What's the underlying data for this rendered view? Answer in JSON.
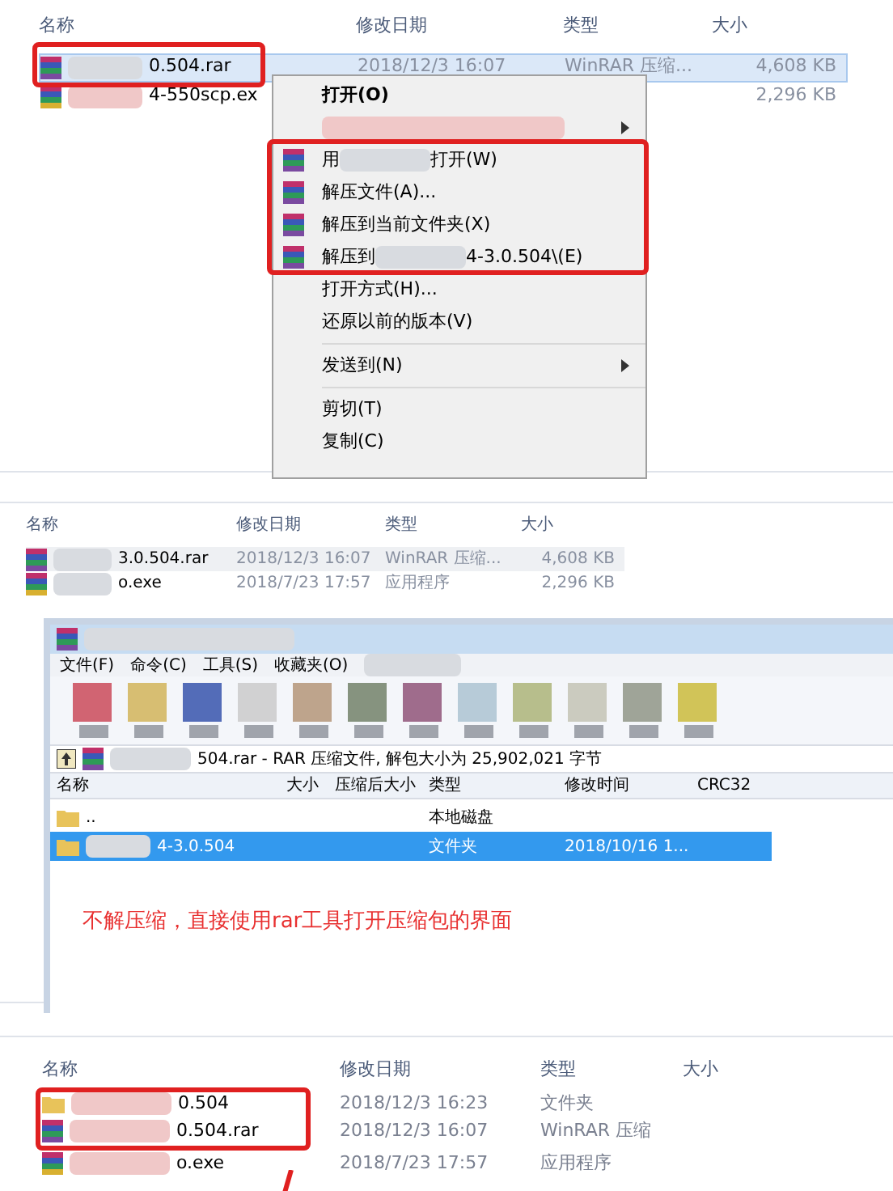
{
  "panel_1": {
    "columns": [
      "名称",
      "修改日期",
      "类型",
      "大小"
    ],
    "rows": [
      {
        "name": "0.504.rar",
        "kind": "rar",
        "date": "2018/12/3 16:07",
        "type": "WinRAR 压缩...",
        "size": "4,608 KB",
        "selected": true
      },
      {
        "name": "4-550scp.ex",
        "kind": "exe",
        "date": "",
        "type": "",
        "size": "2,296 KB",
        "selected": false
      }
    ],
    "context_menu": [
      {
        "kind": "bold",
        "parts": [
          "打开(O)"
        ],
        "submenu": false
      },
      {
        "kind": "blurred",
        "submenu": true
      },
      {
        "kind": "winrar",
        "parts": [
          "用",
          "打开(W)"
        ],
        "submenu": false
      },
      {
        "kind": "winrar",
        "parts": [
          "解压文件(A)..."
        ],
        "submenu": false
      },
      {
        "kind": "winrar",
        "parts": [
          "解压到当前文件夹(X)"
        ],
        "submenu": false
      },
      {
        "kind": "winrar",
        "parts": [
          "解压到",
          "4-3.0.504\\(E)"
        ],
        "submenu": false
      },
      {
        "kind": "plain",
        "parts": [
          "打开方式(H)..."
        ],
        "submenu": false
      },
      {
        "kind": "plain",
        "parts": [
          "还原以前的版本(V)"
        ],
        "submenu": false
      },
      {
        "kind": "separator"
      },
      {
        "kind": "plain",
        "parts": [
          "发送到(N)"
        ],
        "submenu": true
      },
      {
        "kind": "separator"
      },
      {
        "kind": "plain",
        "parts": [
          "剪切(T)"
        ],
        "submenu": false
      },
      {
        "kind": "plain",
        "parts": [
          "复制(C)"
        ],
        "submenu": false
      }
    ]
  },
  "panel_2": {
    "columns": [
      "名称",
      "修改日期",
      "类型",
      "大小"
    ],
    "rows": [
      {
        "name": "3.0.504.rar",
        "kind": "rar",
        "date": "2018/12/3 16:07",
        "type": "WinRAR 压缩...",
        "size": "4,608 KB",
        "selected": true
      },
      {
        "name": "o.exe",
        "kind": "exe",
        "date": "2018/7/23 17:57",
        "type": "应用程序",
        "size": "2,296 KB",
        "selected": false
      }
    ],
    "winrar": {
      "menu": [
        "文件(F)",
        "命令(C)",
        "工具(S)",
        "收藏夹(O)"
      ],
      "address": "504.rar - RAR 压缩文件, 解包大小为 25,902,021 字节",
      "columns": [
        "名称",
        "大小",
        "压缩后大小",
        "类型",
        "修改时间",
        "CRC32"
      ],
      "rows": [
        {
          "name": "..",
          "kind": "folder",
          "type": "本地磁盘",
          "date": "",
          "selected": false
        },
        {
          "name": "4-3.0.504",
          "kind": "folder",
          "type": "文件夹",
          "date": "2018/10/16 1...",
          "selected": true
        }
      ],
      "note": "不解压缩，直接使用rar工具打开压缩包的界面"
    }
  },
  "panel_3": {
    "columns": [
      "名称",
      "修改日期",
      "类型",
      "大小"
    ],
    "rows": [
      {
        "name": "0.504",
        "kind": "folder",
        "date": "2018/12/3 16:23",
        "type": "文件夹",
        "boxed": true
      },
      {
        "name": "0.504.rar",
        "kind": "rar",
        "date": "2018/12/3 16:07",
        "type": "WinRAR 压缩",
        "boxed": true
      },
      {
        "name": "o.exe",
        "kind": "exe",
        "date": "2018/7/23 17:57",
        "type": "应用程序",
        "boxed": false
      }
    ]
  }
}
